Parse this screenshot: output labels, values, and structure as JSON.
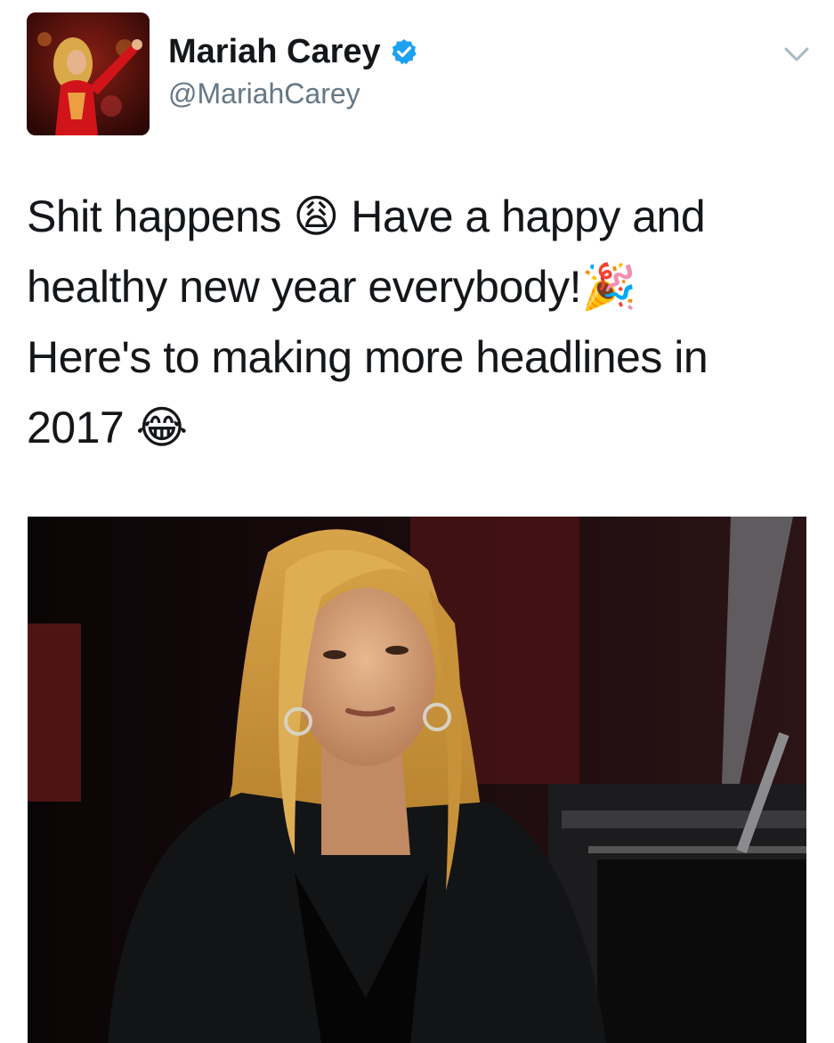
{
  "user": {
    "display_name": "Mariah Carey",
    "handle": "@MariahCarey",
    "verified": true,
    "avatar_icon": "profile-photo-performer-red-outfit"
  },
  "tweet": {
    "lines": [
      "Shit happens 😩 Have a happy and",
      "healthy new year everybody!🎉",
      "Here's to making more headlines in",
      "2017 😂"
    ]
  },
  "media": {
    "type": "gif",
    "subject_icon": "woman-long-blonde-hair-leather-jacket"
  },
  "icons": {
    "verified": "verified-badge-icon",
    "caret": "chevron-down-icon"
  },
  "colors": {
    "text": "#14171a",
    "secondary": "#657786",
    "verified": "#1da1f2",
    "caret": "#aab8c2"
  }
}
